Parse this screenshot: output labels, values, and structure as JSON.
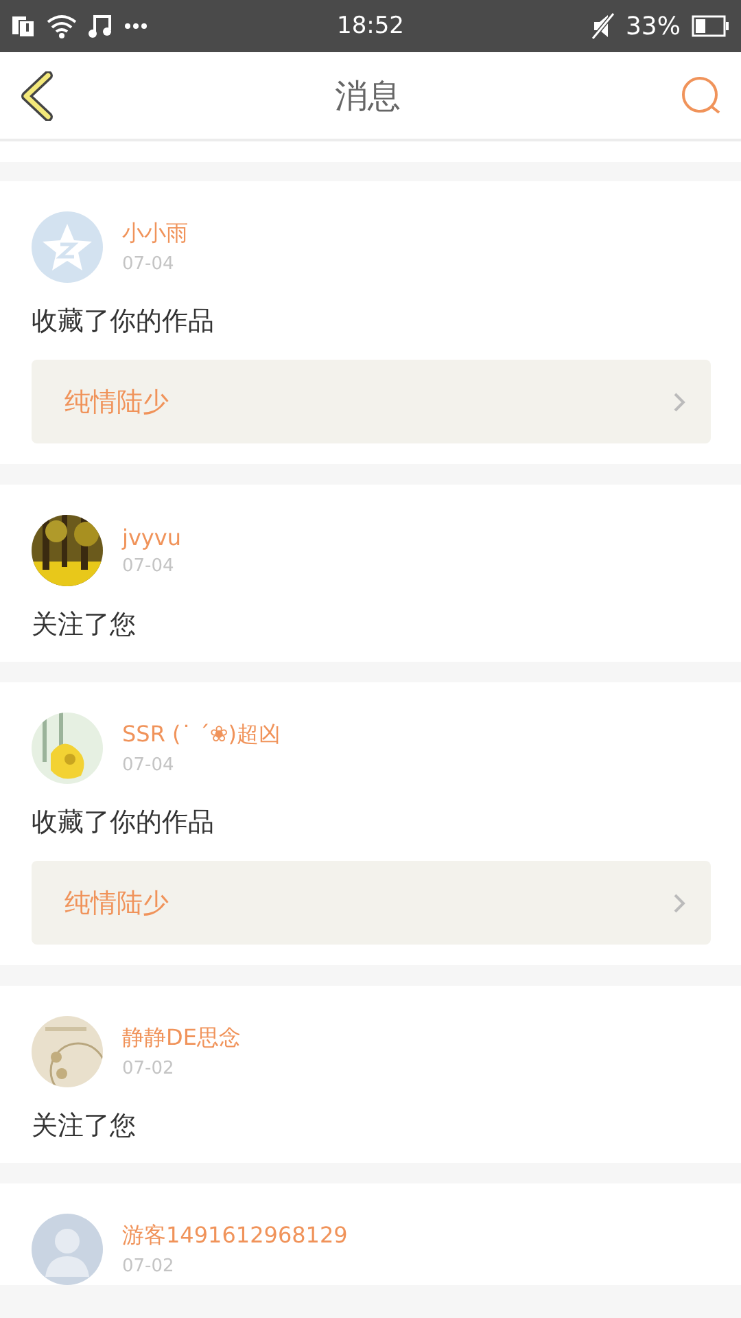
{
  "status_bar": {
    "time": "18:52",
    "battery": "33%"
  },
  "header": {
    "title": "消息"
  },
  "messages": [
    {
      "user": "小小雨",
      "date": "07-04",
      "avatar": {
        "kind": "default"
      },
      "text": "收藏了你的作品",
      "work": "纯情陆少"
    },
    {
      "user": "jvyvu",
      "date": "07-04",
      "text": "关注了您"
    },
    {
      "user": "SSR (˙ ˊ❀)超凶",
      "date": "07-04",
      "text": "收藏了你的作品",
      "work": "纯情陆少"
    },
    {
      "user": "静静DE思念",
      "date": "07-02",
      "text": "关注了您"
    },
    {
      "user": "游客1491612968129",
      "date": "07-02",
      "avatar": {
        "kind": "silhouette"
      }
    }
  ]
}
